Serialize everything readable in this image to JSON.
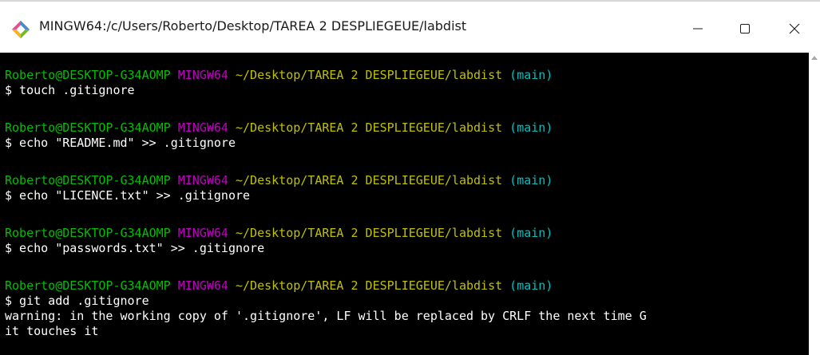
{
  "window": {
    "title": "MINGW64:/c/Users/Roberto/Desktop/TAREA 2 DESPLIEGEUE/labdist",
    "icon": "git-bash-icon",
    "controls": {
      "minimize": "minimize-icon",
      "maximize": "maximize-icon",
      "close": "close-icon"
    }
  },
  "colors": {
    "user": "#00c000",
    "system": "#c000c0",
    "path": "#c0c000",
    "branch": "#00c0c0",
    "text": "#ffffff",
    "background": "#000000"
  },
  "prompt": {
    "user": "Roberto@DESKTOP-G34AOMP",
    "system": "MINGW64",
    "path": "~/Desktop/TAREA 2 DESPLIEGEUE/labdist",
    "branch": "(main)"
  },
  "blocks": [
    {
      "command": "$ touch .gitignore"
    },
    {
      "command": "$ echo \"README.md\" >> .gitignore"
    },
    {
      "command": "$ echo \"LICENCE.txt\" >> .gitignore"
    },
    {
      "command": "$ echo \"passwords.txt\" >> .gitignore"
    },
    {
      "command": "$ git add .gitignore"
    }
  ],
  "output": [
    "warning: in the working copy of '.gitignore', LF will be replaced by CRLF the next time G",
    "it touches it"
  ]
}
